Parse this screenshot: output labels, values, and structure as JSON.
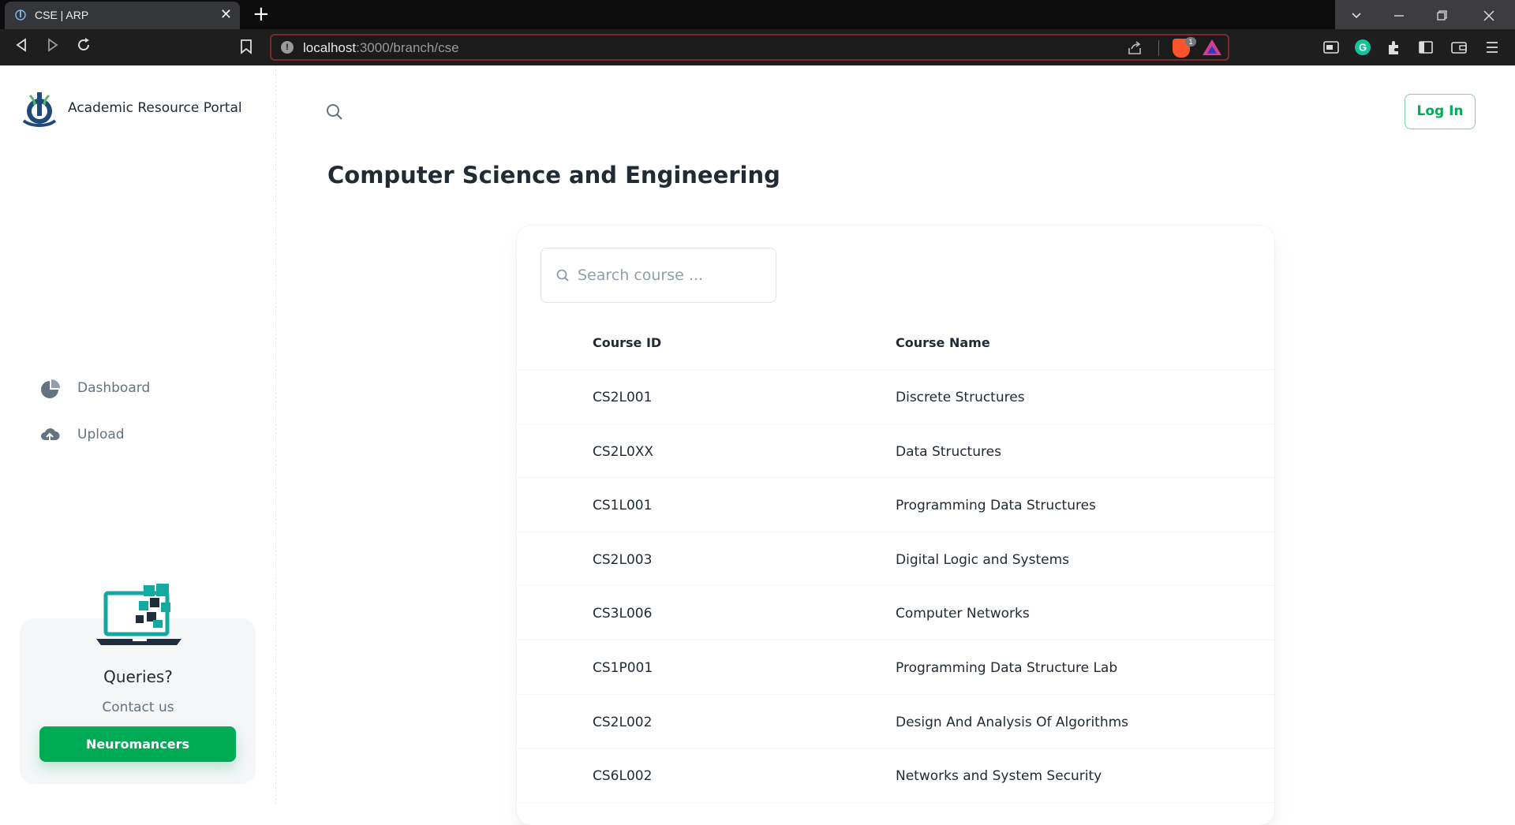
{
  "browser": {
    "tab_title": "CSE | ARP",
    "tab_close": "✕",
    "new_tab": "+",
    "url_host": "localhost",
    "url_path": ":3000/branch/cse",
    "brave_shields_count": "1"
  },
  "app": {
    "name": "Academic Resource Portal"
  },
  "sidebar": {
    "items": [
      {
        "label": "Dashboard",
        "icon": "pie-chart-icon"
      },
      {
        "label": "Upload",
        "icon": "cloud-upload-icon"
      }
    ],
    "help": {
      "title": "Queries?",
      "subtitle": "Contact us",
      "button_label": "Neuromancers"
    }
  },
  "header": {
    "login_label": "Log In"
  },
  "main": {
    "title": "Computer Science and Engineering",
    "search_placeholder": "Search course ...",
    "table": {
      "headers": [
        "Course ID",
        "Course Name"
      ],
      "rows": [
        {
          "id": "CS2L001",
          "name": "Discrete Structures"
        },
        {
          "id": "CS2L0XX",
          "name": "Data Structures"
        },
        {
          "id": "CS1L001",
          "name": "Programming Data Structures"
        },
        {
          "id": "CS2L003",
          "name": "Digital Logic and Systems"
        },
        {
          "id": "CS3L006",
          "name": "Computer Networks"
        },
        {
          "id": "CS1P001",
          "name": "Programming Data Structure Lab"
        },
        {
          "id": "CS2L002",
          "name": "Design And Analysis Of Algorithms"
        },
        {
          "id": "CS6L002",
          "name": "Networks and System Security"
        }
      ]
    }
  },
  "colors": {
    "primary": "#00ab55",
    "text": "#212b36",
    "muted": "#637381"
  }
}
